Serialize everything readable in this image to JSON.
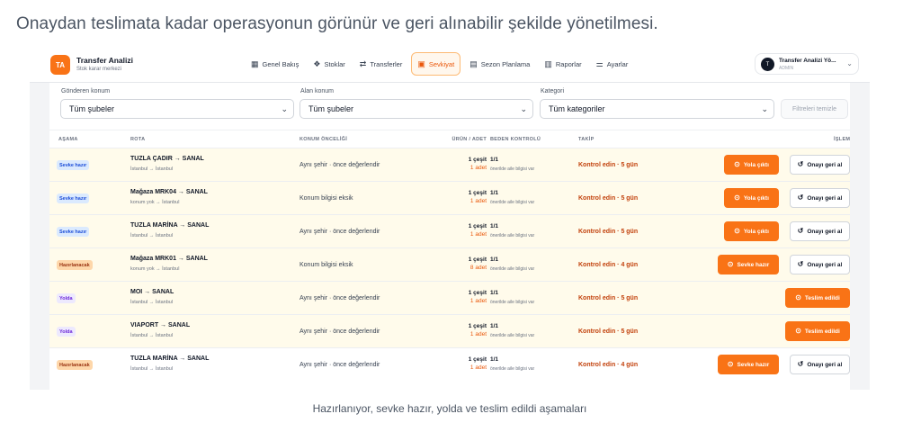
{
  "headline": "Onaydan teslimata kadar operasyonun görünür ve geri alınabilir şekilde yönetilmesi.",
  "caption": "Hazırlanıyor, sevke hazır, yolda ve teslim edildi aşamaları",
  "app": {
    "logo_text": "TA",
    "title": "Transfer Analizi",
    "subtitle": "Stok karar merkezi"
  },
  "nav": [
    {
      "label": "Genel Bakış",
      "icon": "grid-icon",
      "glyph": "▦"
    },
    {
      "label": "Stoklar",
      "icon": "boxes-icon",
      "glyph": "❖"
    },
    {
      "label": "Transferler",
      "icon": "transfer-icon",
      "glyph": "⇄"
    },
    {
      "label": "Sevkiyat",
      "icon": "clipboard-icon",
      "glyph": "▣",
      "active": true
    },
    {
      "label": "Sezon Planlama",
      "icon": "calendar-icon",
      "glyph": "▤"
    },
    {
      "label": "Raporlar",
      "icon": "chart-icon",
      "glyph": "▥"
    },
    {
      "label": "Ayarlar",
      "icon": "sliders-icon",
      "glyph": "⚌"
    }
  ],
  "user": {
    "initial": "T",
    "name": "Transfer Analizi Yö...",
    "role": "ADMIN"
  },
  "filters": {
    "sender_label": "Gönderen konum",
    "sender_value": "Tüm şubeler",
    "receiver_label": "Alan konum",
    "receiver_value": "Tüm şubeler",
    "category_label": "Kategori",
    "category_value": "Tüm kategoriler",
    "clear_label": "Filtreleri temizle"
  },
  "columns": {
    "stage": "AŞAMA",
    "route": "ROTA",
    "priority": "KONUM ÖNCELİĞİ",
    "qty": "ÜRÜN / ADET",
    "size": "BEDEN KONTROLÜ",
    "track": "TAKİP",
    "action": "İŞLEM"
  },
  "rows": [
    {
      "stage": "Sevke hazır",
      "stage_color": "blue",
      "route": "TUZLA ÇADIR → SANAL",
      "route_sub": "İstanbul → İstanbul",
      "priority": "Aynı şehir · önce değerlendir",
      "qty": "1 çeşit",
      "qty_sub": "1 adet",
      "size": "1/1",
      "size_sub": "önerilde aile bilgisi var",
      "track": "Kontrol edin · 5 gün",
      "primary": "Yola çıktı",
      "secondary": "Onayı geri al",
      "tint": true
    },
    {
      "stage": "Sevke hazır",
      "stage_color": "blue",
      "route": "Mağaza MRK04 → SANAL",
      "route_sub": "konum yok → İstanbul",
      "priority": "Konum bilgisi eksik",
      "qty": "1 çeşit",
      "qty_sub": "1 adet",
      "size": "1/1",
      "size_sub": "önerilde aile bilgisi var",
      "track": "Kontrol edin · 5 gün",
      "primary": "Yola çıktı",
      "secondary": "Onayı geri al",
      "tint": true
    },
    {
      "stage": "Sevke hazır",
      "stage_color": "blue",
      "route": "TUZLA MARİNA → SANAL",
      "route_sub": "İstanbul → İstanbul",
      "priority": "Aynı şehir · önce değerlendir",
      "qty": "1 çeşit",
      "qty_sub": "1 adet",
      "size": "1/1",
      "size_sub": "önerilde aile bilgisi var",
      "track": "Kontrol edin · 5 gün",
      "primary": "Yola çıktı",
      "secondary": "Onayı geri al",
      "tint": true
    },
    {
      "stage": "Hazırlanacak",
      "stage_color": "orange",
      "route": "Mağaza MRK01 → SANAL",
      "route_sub": "konum yok → İstanbul",
      "priority": "Konum bilgisi eksik",
      "qty": "1 çeşit",
      "qty_sub": "8 adet",
      "size": "1/1",
      "size_sub": "önerilde aile bilgisi var",
      "track": "Kontrol edin · 4 gün",
      "primary": "Sevke hazır",
      "secondary": "Onayı geri al",
      "tint": true
    },
    {
      "stage": "Yolda",
      "stage_color": "purple",
      "route": "MOI → SANAL",
      "route_sub": "İstanbul → İstanbul",
      "priority": "Aynı şehir · önce değerlendir",
      "qty": "1 çeşit",
      "qty_sub": "1 adet",
      "size": "1/1",
      "size_sub": "önerilde aile bilgisi var",
      "track": "Kontrol edin · 5 gün",
      "primary": "Teslim edildi",
      "secondary": "",
      "tint": true
    },
    {
      "stage": "Yolda",
      "stage_color": "purple",
      "route": "VIAPORT → SANAL",
      "route_sub": "İstanbul → İstanbul",
      "priority": "Aynı şehir · önce değerlendir",
      "qty": "1 çeşit",
      "qty_sub": "1 adet",
      "size": "1/1",
      "size_sub": "önerilde aile bilgisi var",
      "track": "Kontrol edin · 5 gün",
      "primary": "Teslim edildi",
      "secondary": "",
      "tint": true
    },
    {
      "stage": "Hazırlanacak",
      "stage_color": "orange",
      "route": "TUZLA MARİNA → SANAL",
      "route_sub": "İstanbul → İstanbul",
      "priority": "Aynı şehir · önce değerlendir",
      "qty": "1 çeşit",
      "qty_sub": "1 adet",
      "size": "1/1",
      "size_sub": "önerilde aile bilgisi var",
      "track": "Kontrol edin · 4 gün",
      "primary": "Sevke hazır",
      "secondary": "Onayı geri al",
      "tint": false
    }
  ],
  "colors": {
    "accent": "#f97316",
    "track": "#c2410c"
  }
}
